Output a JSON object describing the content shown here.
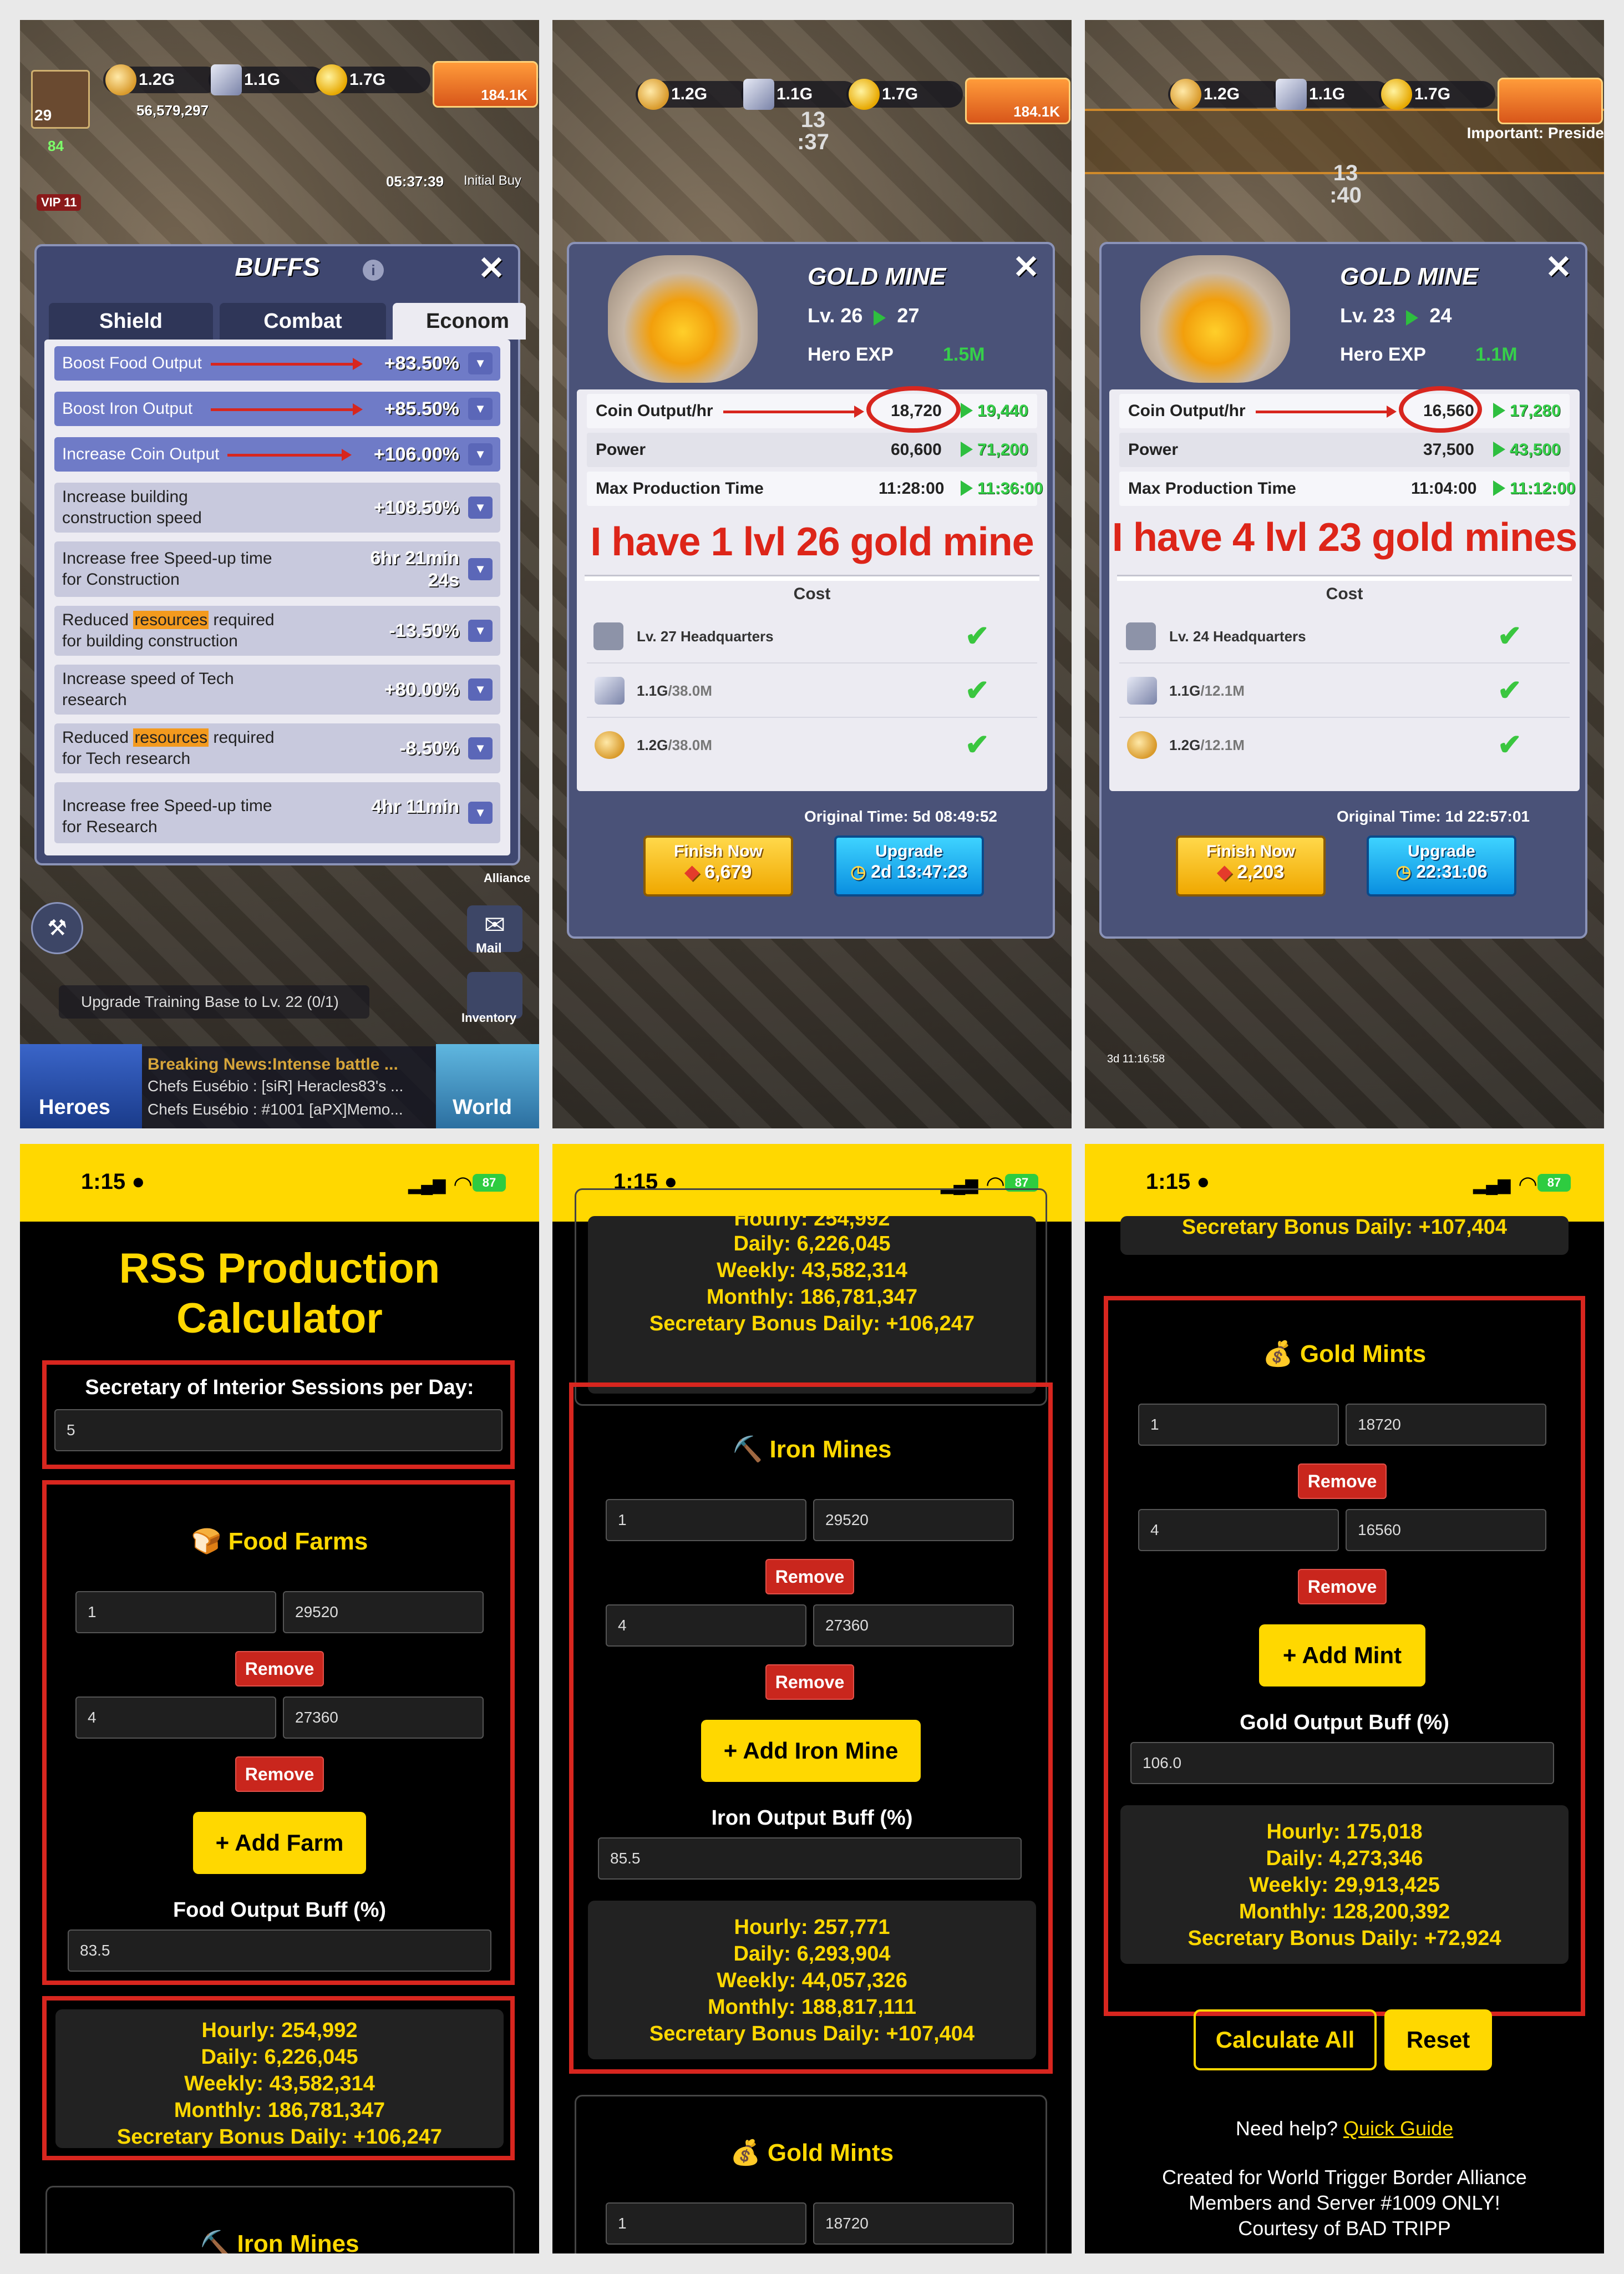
{
  "colors": {
    "accent_yellow": "#ffd800",
    "annotation_red": "#d8261f",
    "gain_green": "#36d04a"
  },
  "game_hud": {
    "food": "1.2G",
    "iron": "1.1G",
    "gold": "1.7G",
    "power": "56,579,297",
    "level": "29",
    "vip": "VIP 11",
    "stamina": "84",
    "shop_value": "184.1K",
    "timer": "05:37:39",
    "initial_buy": "Initial Buy",
    "alliance": "Alliance",
    "mail": "Mail",
    "inventory": "Inventory",
    "heroes": "Heroes",
    "world": "World",
    "quest": "Upgrade Training Base to Lv. 22 (0/1)",
    "news_title": "Breaking News:Intense battle ...",
    "news_line1": "Chefs Eusébio : [siR] Heracles83's ...",
    "news_line2": "Chefs Eusébio : #1001 [aPX]Memo..."
  },
  "buffs": {
    "title": "BUFFS",
    "tabs": [
      "Shield",
      "Combat",
      "Econom"
    ],
    "rows": [
      {
        "label": "Boost Food Output",
        "value": "+83.50%"
      },
      {
        "label": "Boost Iron Output",
        "value": "+85.50%"
      },
      {
        "label": "Increase Coin Output",
        "value": "+106.00%"
      },
      {
        "label1": "Increase building",
        "label2": "construction speed",
        "value": "+108.50%"
      },
      {
        "label1": "Increase free Speed-up time",
        "label2": "for Construction",
        "value1": "6hr 21min",
        "value2": "24s"
      },
      {
        "pre": "Reduced ",
        "hl": "resources",
        "post": " required",
        "label2": "for building construction",
        "value": "-13.50%"
      },
      {
        "label1": "Increase speed of Tech",
        "label2": "research",
        "value": "+80.00%"
      },
      {
        "pre": "Reduced ",
        "hl": "resources",
        "post": " required",
        "label2": "for Tech research",
        "value": "-8.50%"
      },
      {
        "label1": "Increase free Speed-up time",
        "label2": "for Research",
        "value1": "4hr 11min"
      }
    ]
  },
  "mine26": {
    "title": "GOLD MINE",
    "lv": "Lv. 26",
    "lv_next": "27",
    "hero_exp_label": "Hero EXP",
    "hero_exp": "1.5M",
    "building_label": "13\n:37",
    "stats": [
      {
        "label": "Coin Output/hr",
        "cur": "18,720",
        "next": "19,440"
      },
      {
        "label": "Power",
        "cur": "60,600",
        "next": "71,200"
      },
      {
        "label": "Max Production Time",
        "cur": "11:28:00",
        "next": "11:36:00"
      }
    ],
    "note": "I have 1 lvl 26 gold mine",
    "cost_title": "Cost",
    "costs": [
      {
        "a": "Lv. 27 Headquarters",
        "b": ""
      },
      {
        "a": "1.1G",
        "b": "/38.0M"
      },
      {
        "a": "1.2G",
        "b": "/38.0M"
      }
    ],
    "original_time": "Original Time: 5d 08:49:52",
    "finish_label": "Finish Now",
    "finish_cost": "6,679",
    "upgrade_label": "Upgrade",
    "upgrade_time": "2d 13:47:23"
  },
  "mine23": {
    "title": "GOLD MINE",
    "lv": "Lv. 23",
    "lv_next": "24",
    "hero_exp_label": "Hero EXP",
    "hero_exp": "1.1M",
    "building_label": "13\n:40",
    "important": "Important: Preside",
    "timer_small": "3d 11:16:58",
    "stats": [
      {
        "label": "Coin Output/hr",
        "cur": "16,560",
        "next": "17,280"
      },
      {
        "label": "Power",
        "cur": "37,500",
        "next": "43,500"
      },
      {
        "label": "Max Production Time",
        "cur": "11:04:00",
        "next": "11:12:00"
      }
    ],
    "note": "I have 4 lvl 23 gold mines",
    "cost_title": "Cost",
    "costs": [
      {
        "a": "Lv. 24 Headquarters",
        "b": ""
      },
      {
        "a": "1.1G",
        "b": "/12.1M"
      },
      {
        "a": "1.2G",
        "b": "/12.1M"
      }
    ],
    "original_time": "Original Time: 1d 22:57:01",
    "finish_label": "Finish Now",
    "finish_cost": "2,203",
    "upgrade_label": "Upgrade",
    "upgrade_time": "22:31:06"
  },
  "phone": {
    "time": "1:15",
    "battery": "87"
  },
  "calc1": {
    "title1": "RSS Production",
    "title2": "Calculator",
    "sessions_label": "Secretary of Interior Sessions per Day:",
    "sessions_value": "5",
    "food_title": "🍞 Food Farms",
    "food_rows": [
      {
        "count": "1",
        "output": "29520"
      },
      {
        "count": "4",
        "output": "27360"
      }
    ],
    "remove": "Remove",
    "add_farm": "+ Add Farm",
    "food_buff_label": "Food Output Buff (%)",
    "food_buff": "83.5",
    "results": [
      "Hourly: 254,992",
      "Daily: 6,226,045",
      "Weekly: 43,582,314",
      "Monthly: 186,781,347",
      "Secretary Bonus Daily: +106,247"
    ],
    "next_section": "⛏️ Iron Mines"
  },
  "calc2": {
    "top_results": [
      "Hourly: 254,992",
      "Daily: 6,226,045",
      "Weekly: 43,582,314",
      "Monthly: 186,781,347",
      "Secretary Bonus Daily: +106,247"
    ],
    "iron_title": "⛏️ Iron Mines",
    "iron_rows": [
      {
        "count": "1",
        "output": "29520"
      },
      {
        "count": "4",
        "output": "27360"
      }
    ],
    "remove": "Remove",
    "add_iron": "+ Add Iron Mine",
    "iron_buff_label": "Iron Output Buff (%)",
    "iron_buff": "85.5",
    "results": [
      "Hourly: 257,771",
      "Daily: 6,293,904",
      "Weekly: 44,057,326",
      "Monthly: 188,817,111",
      "Secretary Bonus Daily: +107,404"
    ],
    "gold_title": "💰 Gold Mints",
    "gold_row": {
      "count": "1",
      "output": "18720"
    }
  },
  "calc3": {
    "top_result": "Secretary Bonus Daily: +107,404",
    "gold_title": "💰 Gold Mints",
    "gold_rows": [
      {
        "count": "1",
        "output": "18720"
      },
      {
        "count": "4",
        "output": "16560"
      }
    ],
    "remove": "Remove",
    "add_mint": "+ Add Mint",
    "gold_buff_label": "Gold Output Buff (%)",
    "gold_buff": "106.0",
    "results": [
      "Hourly: 175,018",
      "Daily: 4,273,346",
      "Weekly: 29,913,425",
      "Monthly: 128,200,392",
      "Secretary Bonus Daily: +72,924"
    ],
    "calculate_all": "Calculate All",
    "reset": "Reset",
    "help_pre": "Need help? ",
    "help_link": "Quick Guide",
    "credit1": "Created for World Trigger Border Alliance",
    "credit2": "Members and Server #1009 ONLY!",
    "credit3": "Courtesy of BAD TRIPP"
  }
}
